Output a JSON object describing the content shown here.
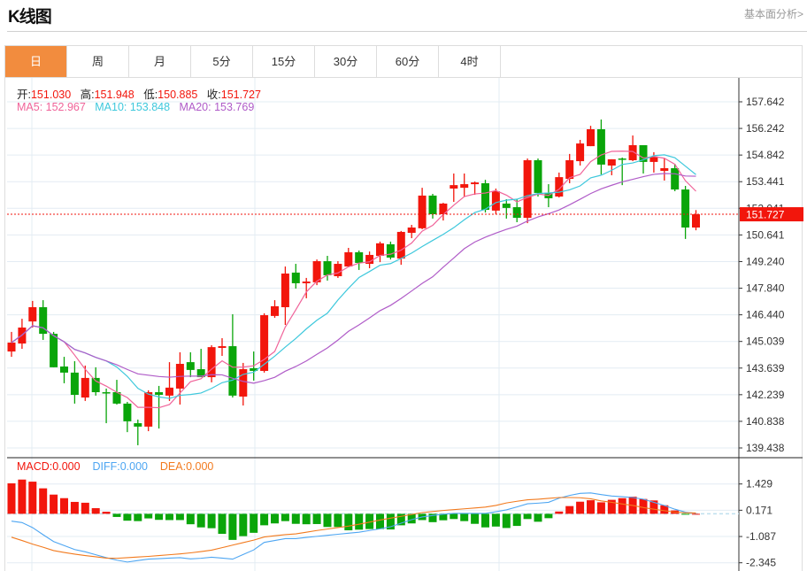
{
  "header": {
    "title": "K线图",
    "fundamental_link": "基本面分析>"
  },
  "tabs": [
    {
      "label": "日",
      "active": true
    },
    {
      "label": "周",
      "active": false
    },
    {
      "label": "月",
      "active": false
    },
    {
      "label": "5分",
      "active": false
    },
    {
      "label": "15分",
      "active": false
    },
    {
      "label": "30分",
      "active": false
    },
    {
      "label": "60分",
      "active": false
    },
    {
      "label": "4时",
      "active": false
    }
  ],
  "ohlc_legend": {
    "open_label": "开:",
    "open": "151.030",
    "high_label": "高:",
    "high": "151.948",
    "low_label": "低:",
    "low": "150.885",
    "close_label": "收:",
    "close": "151.727"
  },
  "ma_legend": {
    "ma5": "MA5: 152.967",
    "ma10": "MA10: 153.848",
    "ma20": "MA20: 153.769"
  },
  "macd_legend": {
    "macd": "MACD:0.000",
    "diff": "DIFF:0.000",
    "dea": "DEA:0.000"
  },
  "colors": {
    "up": "#f2160c",
    "down": "#0aa50a",
    "ma5": "#f0649a",
    "ma10": "#3ec8dc",
    "ma20": "#b05cc8",
    "diff": "#4ea6f2",
    "dea": "#f27a1e",
    "accent": "#f28c3e"
  },
  "chart_data": [
    {
      "type": "candlestick",
      "title": "K线图",
      "y_ticks": [
        "157.642",
        "156.242",
        "154.842",
        "153.441",
        "152.041",
        "150.641",
        "149.240",
        "147.840",
        "146.440",
        "145.039",
        "143.639",
        "142.239",
        "140.838",
        "139.438"
      ],
      "ylim": [
        139.438,
        157.642
      ],
      "last_price": "151.727",
      "ma_periods": [
        5,
        10,
        20
      ],
      "ohlc": [
        [
          144.51,
          145.54,
          144.23,
          144.98
        ],
        [
          144.93,
          146.23,
          144.65,
          145.77
        ],
        [
          146.09,
          147.17,
          145.77,
          146.84
        ],
        [
          146.84,
          147.21,
          145.12,
          145.44
        ],
        [
          145.44,
          145.54,
          143.68,
          143.68
        ],
        [
          143.72,
          144.23,
          142.84,
          143.4
        ],
        [
          143.4,
          144.0,
          141.77,
          142.23
        ],
        [
          142.09,
          143.77,
          141.91,
          143.12
        ],
        [
          143.12,
          143.68,
          142.19,
          142.37
        ],
        [
          142.37,
          142.56,
          140.74,
          142.33
        ],
        [
          142.37,
          143.02,
          141.72,
          141.77
        ],
        [
          141.77,
          141.86,
          140.27,
          140.84
        ],
        [
          140.74,
          140.93,
          139.58,
          140.56
        ],
        [
          140.56,
          142.47,
          140.32,
          142.37
        ],
        [
          142.37,
          142.7,
          140.46,
          142.23
        ],
        [
          142.19,
          143.95,
          141.91,
          142.61
        ],
        [
          142.56,
          144.47,
          141.72,
          143.86
        ],
        [
          143.95,
          144.47,
          143.16,
          143.54
        ],
        [
          143.58,
          144.65,
          143.16,
          143.16
        ],
        [
          143.16,
          144.84,
          142.89,
          144.74
        ],
        [
          144.7,
          145.21,
          144.28,
          144.79
        ],
        [
          144.79,
          146.47,
          142.09,
          142.19
        ],
        [
          142.14,
          143.91,
          141.67,
          143.58
        ],
        [
          143.63,
          144.51,
          142.98,
          143.49
        ],
        [
          143.49,
          146.52,
          143.4,
          146.42
        ],
        [
          146.38,
          147.21,
          146.28,
          146.89
        ],
        [
          146.84,
          148.98,
          145.91,
          148.61
        ],
        [
          148.66,
          149.12,
          147.82,
          148.1
        ],
        [
          148.1,
          148.38,
          147.31,
          148.19
        ],
        [
          148.15,
          149.35,
          148.0,
          149.26
        ],
        [
          149.26,
          149.54,
          148.24,
          148.52
        ],
        [
          148.47,
          149.26,
          148.38,
          149.12
        ],
        [
          148.98,
          149.96,
          148.98,
          149.73
        ],
        [
          149.73,
          149.82,
          148.8,
          149.17
        ],
        [
          149.12,
          149.77,
          148.89,
          149.59
        ],
        [
          149.54,
          150.29,
          149.21,
          150.2
        ],
        [
          150.15,
          150.29,
          149.35,
          149.45
        ],
        [
          149.4,
          150.85,
          149.07,
          150.8
        ],
        [
          150.75,
          151.17,
          150.47,
          151.03
        ],
        [
          150.99,
          153.12,
          150.94,
          152.71
        ],
        [
          152.71,
          152.8,
          151.5,
          151.73
        ],
        [
          151.73,
          152.33,
          151.4,
          152.29
        ],
        [
          153.08,
          153.87,
          152.38,
          153.26
        ],
        [
          153.12,
          153.87,
          152.66,
          153.31
        ],
        [
          153.31,
          153.45,
          152.75,
          153.4
        ],
        [
          153.36,
          153.54,
          151.82,
          151.96
        ],
        [
          151.92,
          153.08,
          151.73,
          152.94
        ],
        [
          152.29,
          152.52,
          151.5,
          152.06
        ],
        [
          152.1,
          152.52,
          151.31,
          151.54
        ],
        [
          151.54,
          154.66,
          151.26,
          154.57
        ],
        [
          154.57,
          154.66,
          152.66,
          152.85
        ],
        [
          152.85,
          153.31,
          152.1,
          152.57
        ],
        [
          152.66,
          153.92,
          152.61,
          153.68
        ],
        [
          153.59,
          154.9,
          153.36,
          154.57
        ],
        [
          154.52,
          155.64,
          154.29,
          155.45
        ],
        [
          155.31,
          156.38,
          155.31,
          156.2
        ],
        [
          156.2,
          156.71,
          153.82,
          154.34
        ],
        [
          154.29,
          154.62,
          153.78,
          154.62
        ],
        [
          154.66,
          154.71,
          153.26,
          154.62
        ],
        [
          154.57,
          155.87,
          154.52,
          155.36
        ],
        [
          155.36,
          155.36,
          153.87,
          154.48
        ],
        [
          154.48,
          154.99,
          153.92,
          154.76
        ],
        [
          154.01,
          154.66,
          153.5,
          154.15
        ],
        [
          154.15,
          154.38,
          152.94,
          153.03
        ],
        [
          153.03,
          153.22,
          150.43,
          151.03
        ],
        [
          151.03,
          151.948,
          150.885,
          151.727
        ]
      ]
    },
    {
      "type": "bar+line",
      "title": "MACD",
      "y_ticks": [
        "1.429",
        "0.171",
        "-1.087",
        "-2.345"
      ],
      "ylim": [
        -2.345,
        1.429
      ],
      "macd": [
        1.46,
        1.64,
        1.54,
        1.22,
        0.92,
        0.75,
        0.57,
        0.53,
        0.27,
        0.1,
        -0.15,
        -0.33,
        -0.35,
        -0.22,
        -0.29,
        -0.3,
        -0.3,
        -0.5,
        -0.65,
        -0.69,
        -0.96,
        -1.25,
        -1.07,
        -0.91,
        -0.55,
        -0.46,
        -0.35,
        -0.48,
        -0.5,
        -0.49,
        -0.63,
        -0.63,
        -0.79,
        -0.76,
        -0.73,
        -0.73,
        -0.75,
        -0.55,
        -0.46,
        -0.3,
        -0.4,
        -0.31,
        -0.25,
        -0.35,
        -0.48,
        -0.65,
        -0.61,
        -0.68,
        -0.58,
        -0.25,
        -0.38,
        -0.21,
        0.11,
        0.37,
        0.58,
        0.65,
        0.55,
        0.67,
        0.75,
        0.82,
        0.71,
        0.64,
        0.41,
        0.16,
        -0.04,
        0.0
      ],
      "diff": [
        -0.35,
        -0.42,
        -0.66,
        -1.0,
        -1.33,
        -1.52,
        -1.71,
        -1.82,
        -1.96,
        -2.1,
        -2.22,
        -2.31,
        -2.24,
        -2.17,
        -2.15,
        -2.12,
        -2.1,
        -2.16,
        -2.13,
        -2.08,
        -2.12,
        -2.17,
        -1.95,
        -1.73,
        -1.37,
        -1.28,
        -1.19,
        -1.19,
        -1.13,
        -1.08,
        -1.03,
        -0.98,
        -0.93,
        -0.88,
        -0.8,
        -0.72,
        -0.62,
        -0.45,
        -0.28,
        -0.15,
        -0.08,
        -0.02,
        0.02,
        0.02,
        0.02,
        0.02,
        0.1,
        0.19,
        0.33,
        0.48,
        0.51,
        0.55,
        0.75,
        0.88,
        0.98,
        1.0,
        0.92,
        0.85,
        0.82,
        0.78,
        0.7,
        0.55,
        0.4,
        0.22,
        0.08,
        0.02
      ],
      "dea": [
        -1.12,
        -1.28,
        -1.45,
        -1.6,
        -1.76,
        -1.85,
        -1.93,
        -2.0,
        -2.06,
        -2.12,
        -2.13,
        -2.1,
        -2.07,
        -2.04,
        -2.0,
        -1.96,
        -1.92,
        -1.87,
        -1.81,
        -1.74,
        -1.62,
        -1.5,
        -1.38,
        -1.26,
        -1.11,
        -1.05,
        -1.0,
        -0.96,
        -0.88,
        -0.8,
        -0.73,
        -0.66,
        -0.59,
        -0.5,
        -0.4,
        -0.3,
        -0.21,
        -0.12,
        -0.03,
        0.06,
        0.11,
        0.16,
        0.2,
        0.24,
        0.28,
        0.32,
        0.4,
        0.52,
        0.6,
        0.67,
        0.7,
        0.74,
        0.78,
        0.78,
        0.77,
        0.72,
        0.62,
        0.55,
        0.47,
        0.4,
        0.3,
        0.22,
        0.15,
        0.08,
        0.05,
        0.04
      ]
    }
  ]
}
